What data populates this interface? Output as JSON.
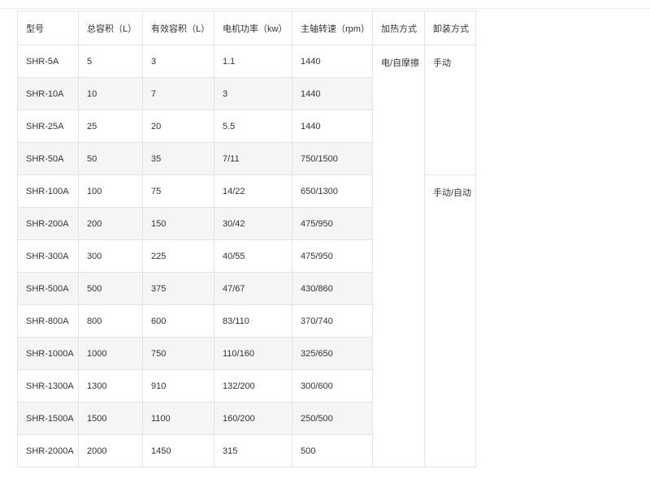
{
  "table": {
    "headers": [
      "型号",
      "总容积（L）",
      "有效容积（L）",
      "电机功率（kw）",
      "主轴转速（rpm）",
      "加热方式",
      "卸装方式"
    ],
    "rows": [
      [
        "SHR-5A",
        "5",
        "3",
        "1.1",
        "1440"
      ],
      [
        "SHR-10A",
        "10",
        "7",
        "3",
        "1440"
      ],
      [
        "SHR-25A",
        "25",
        "20",
        "5.5",
        "1440"
      ],
      [
        "SHR-50A",
        "50",
        "35",
        "7/11",
        "750/1500"
      ],
      [
        "SHR-100A",
        "100",
        "75",
        "14/22",
        "650/1300"
      ],
      [
        "SHR-200A",
        "200",
        "150",
        "30/42",
        "475/950"
      ],
      [
        "SHR-300A",
        "300",
        "225",
        "40/55",
        "475/950"
      ],
      [
        "SHR-500A",
        "500",
        "375",
        "47/67",
        "430/860"
      ],
      [
        "SHR-800A",
        "800",
        "600",
        "83/110",
        "370/740"
      ],
      [
        "SHR-1000A",
        "1000",
        "750",
        "110/160",
        "325/650"
      ],
      [
        "SHR-1300A",
        "1300",
        "910",
        "132/200",
        "300/600"
      ],
      [
        "SHR-1500A",
        "1500",
        "1100",
        "160/200",
        "250/500"
      ],
      [
        "SHR-2000A",
        "2000",
        "1450",
        "315",
        "500"
      ]
    ],
    "heating": "电/自摩擦",
    "discharge_small": "手动",
    "discharge_large": "手动/自动"
  }
}
